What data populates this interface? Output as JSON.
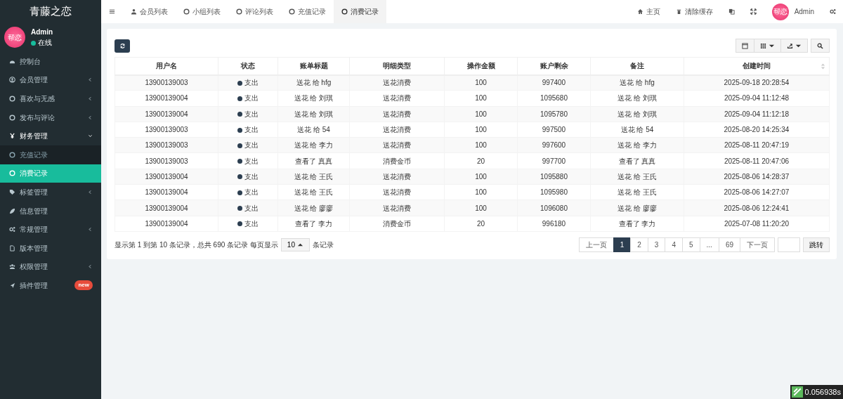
{
  "sidebar": {
    "brand": "青藤之恋",
    "user": {
      "avatar_text": "帮恋",
      "name": "Admin",
      "status": "在线"
    },
    "items": [
      {
        "label": "控制台"
      },
      {
        "label": "会员管理",
        "expanded": false
      },
      {
        "label": "喜欢与无感",
        "expanded": false
      },
      {
        "label": "发布与评论",
        "expanded": false
      },
      {
        "label": "财务管理",
        "expanded": true,
        "children": [
          {
            "label": "充值记录",
            "selected": false
          },
          {
            "label": "消费记录",
            "selected": true
          }
        ]
      },
      {
        "label": "标签管理",
        "expanded": false
      },
      {
        "label": "信息管理"
      },
      {
        "label": "常规管理",
        "expanded": false
      },
      {
        "label": "版本管理"
      },
      {
        "label": "权限管理",
        "expanded": false
      },
      {
        "label": "插件管理",
        "badge": "new"
      }
    ]
  },
  "tabs": [
    {
      "label": "会员列表",
      "selected": false
    },
    {
      "label": "小组列表",
      "selected": false
    },
    {
      "label": "评论列表",
      "selected": false
    },
    {
      "label": "充值记录",
      "selected": false
    },
    {
      "label": "消费记录",
      "selected": true
    }
  ],
  "topbar": {
    "home": "主页",
    "clear_cache": "清除缓存",
    "avatar_text": "帮恋",
    "user": "Admin"
  },
  "table": {
    "columns": [
      "用户名",
      "状态",
      "账单标题",
      "明细类型",
      "操作金额",
      "账户剩余",
      "备注",
      "创建时间"
    ],
    "rows": [
      [
        "13900139003",
        "支出",
        "送花 给 hfg",
        "送花消费",
        "100",
        "997400",
        "送花 给 hfg",
        "2025-09-18 20:28:54"
      ],
      [
        "13900139004",
        "支出",
        "送花 给 刘琪",
        "送花消费",
        "100",
        "1095680",
        "送花 给 刘琪",
        "2025-09-04 11:12:48"
      ],
      [
        "13900139004",
        "支出",
        "送花 给 刘琪",
        "送花消费",
        "100",
        "1095780",
        "送花 给 刘琪",
        "2025-09-04 11:12:18"
      ],
      [
        "13900139003",
        "支出",
        "送花 给 54",
        "送花消费",
        "100",
        "997500",
        "送花 给 54",
        "2025-08-20 14:25:34"
      ],
      [
        "13900139003",
        "支出",
        "送花 给 李力",
        "送花消费",
        "100",
        "997600",
        "送花 给 李力",
        "2025-08-11 20:47:19"
      ],
      [
        "13900139003",
        "支出",
        "查看了 真真",
        "消费金币",
        "20",
        "997700",
        "查看了 真真",
        "2025-08-11 20:47:06"
      ],
      [
        "13900139004",
        "支出",
        "送花 给 王氏",
        "送花消费",
        "100",
        "1095880",
        "送花 给 王氏",
        "2025-08-06 14:28:37"
      ],
      [
        "13900139004",
        "支出",
        "送花 给 王氏",
        "送花消费",
        "100",
        "1095980",
        "送花 给 王氏",
        "2025-08-06 14:27:07"
      ],
      [
        "13900139004",
        "支出",
        "送花 给 廖廖",
        "送花消费",
        "100",
        "1096080",
        "送花 给 廖廖",
        "2025-08-06 12:24:41"
      ],
      [
        "13900139004",
        "支出",
        "查看了 李力",
        "消费金币",
        "20",
        "996180",
        "查看了 李力",
        "2025-07-08 11:20:20"
      ]
    ]
  },
  "footer": {
    "summary": "显示第 1 到第 10 条记录，总共 690 条记录 每页显示",
    "page_size": "10",
    "suffix": "条记录"
  },
  "pagination": {
    "prev": "上一页",
    "pages": [
      {
        "label": "1",
        "selected": true
      },
      {
        "label": "2",
        "selected": false
      },
      {
        "label": "3",
        "selected": false
      },
      {
        "label": "4",
        "selected": false
      },
      {
        "label": "5",
        "selected": false
      },
      {
        "label": "...",
        "selected": false
      },
      {
        "label": "69",
        "selected": false
      }
    ],
    "next": "下一页",
    "jump": "跳转"
  },
  "trace": "0.056938s"
}
